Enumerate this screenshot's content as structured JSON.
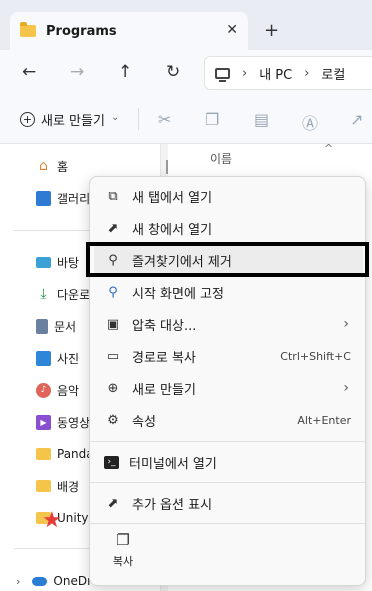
{
  "tab": {
    "title": "Programs",
    "close": "✕",
    "new": "+"
  },
  "nav": {
    "back": "←",
    "forward": "→",
    "up": "↑",
    "refresh": "↻",
    "separator": "›",
    "crumb1": "내 PC",
    "crumb2": "로컬"
  },
  "toolbar": {
    "new_label": "새로 만들기",
    "new_caret": "⌄"
  },
  "sidebar": {
    "items": [
      {
        "label": "홈",
        "icon": "home-icon"
      },
      {
        "label": "갤러리",
        "icon": "gallery-icon"
      },
      {
        "label": "바탕",
        "icon": "desktop-icon"
      },
      {
        "label": "다운로",
        "icon": "download-icon"
      },
      {
        "label": "문서",
        "icon": "document-icon"
      },
      {
        "label": "사진",
        "icon": "pictures-icon"
      },
      {
        "label": "음악",
        "icon": "music-icon"
      },
      {
        "label": "동영상",
        "icon": "videos-icon"
      },
      {
        "label": "Panda",
        "icon": "folder-icon"
      },
      {
        "label": "배경",
        "icon": "folder-icon"
      },
      {
        "label": "Unity",
        "icon": "folder-icon"
      },
      {
        "label": "OneDrive",
        "icon": "onedrive-icon"
      }
    ],
    "expand_caret": "›"
  },
  "main": {
    "column_header": "이름",
    "sort_arrow": "^"
  },
  "context_menu": {
    "items": [
      {
        "label": "새 탭에서 열기",
        "icon": "open-new-tab-icon"
      },
      {
        "label": "새 창에서 열기",
        "icon": "open-new-window-icon"
      },
      {
        "label": "즐겨찾기에서 제거",
        "icon": "unpin-icon"
      },
      {
        "label": "시작 화면에 고정",
        "icon": "pin-icon"
      },
      {
        "label": "압축 대상...",
        "icon": "zip-icon",
        "arrow": "›"
      },
      {
        "label": "경로로 복사",
        "icon": "copy-path-icon",
        "shortcut": "Ctrl+Shift+C"
      },
      {
        "label": "새로 만들기",
        "icon": "new-icon",
        "arrow": "›"
      },
      {
        "label": "속성",
        "icon": "wrench-icon",
        "shortcut": "Alt+Enter"
      },
      {
        "label": "터미널에서 열기",
        "icon": "terminal-icon"
      },
      {
        "label": "추가 옵션 표시",
        "icon": "more-options-icon"
      }
    ],
    "copy_label": "복사",
    "highlighted_index": 2
  },
  "annotation": {
    "highlight_color": "#000000",
    "star_color": "#e53b3b"
  }
}
